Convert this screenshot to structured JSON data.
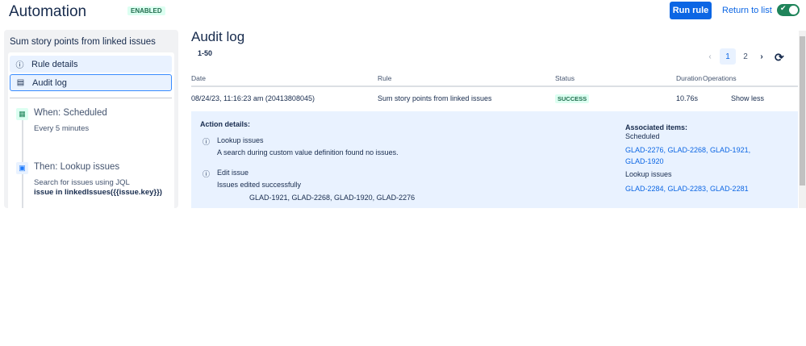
{
  "header": {
    "title": "Automation",
    "status": "ENABLED",
    "run_rule": "Run rule",
    "return_to_list": "Return to list",
    "toggle_on": true
  },
  "sidebar": {
    "rule_name": "Sum story points from linked issues",
    "nav": [
      {
        "label": "Rule details",
        "icon": "info-icon"
      },
      {
        "label": "Audit log",
        "icon": "document-icon"
      }
    ],
    "steps": [
      {
        "title": "When: Scheduled",
        "sub": "Every 5 minutes"
      },
      {
        "title": "Then: Lookup issues",
        "sub": "Search for issues using JQL",
        "jql": "issue in linkedIssues({{issue.key}})"
      }
    ]
  },
  "main": {
    "title": "Audit log",
    "range": "1-50",
    "pagination": {
      "pages": [
        "1",
        "2"
      ],
      "current": "1"
    },
    "columns": [
      "Date",
      "Rule",
      "Status",
      "Duration",
      "Operations"
    ],
    "row": {
      "date": "08/24/23, 11:16:23 am (20413808045)",
      "rule": "Sum story points from linked issues",
      "status": "SUCCESS",
      "duration": "10.76s",
      "operation": "Show less"
    },
    "details": {
      "heading": "Action details:",
      "actions": [
        {
          "name": "Lookup issues",
          "message": "A search during custom value definition found no issues."
        },
        {
          "name": "Edit issue",
          "message": "Issues edited successfully",
          "issues": "GLAD-1921, GLAD-2268, GLAD-1920, GLAD-2276"
        }
      ],
      "associated": {
        "heading": "Associated items:",
        "groups": [
          {
            "label": "Scheduled",
            "line1": "GLAD-2276, GLAD-2268, GLAD-1921,",
            "line2": "GLAD-1920"
          },
          {
            "label": "Lookup issues",
            "line1": "GLAD-2284, GLAD-2283, GLAD-2281"
          }
        ]
      }
    }
  },
  "colors": {
    "accent": "#0c66e4",
    "success": "#216e4e",
    "toggle": "#1f845a"
  }
}
